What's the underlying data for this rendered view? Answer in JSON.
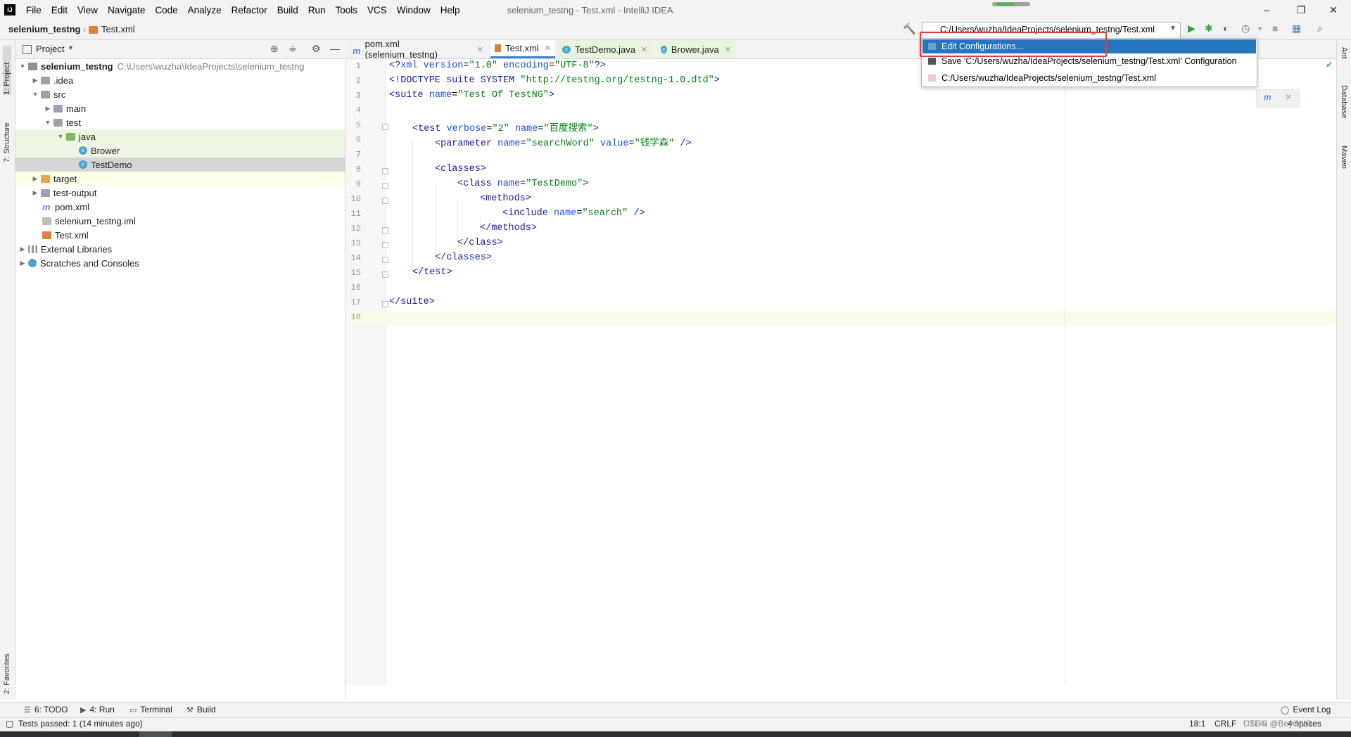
{
  "titlebar": {
    "menu": [
      "File",
      "Edit",
      "View",
      "Navigate",
      "Code",
      "Analyze",
      "Refactor",
      "Build",
      "Run",
      "Tools",
      "VCS",
      "Window",
      "Help"
    ],
    "window_title": "selenium_testng - Test.xml - IntelliJ IDEA",
    "minimize": "–",
    "restore": "❐",
    "close": "✕"
  },
  "navbar": {
    "project": "selenium_testng",
    "file": "Test.xml",
    "run_config": "C:/Users/wuzha/IdeaProjects/selenium_testng/Test.xml"
  },
  "run_dropdown": {
    "items": [
      "Edit Configurations...",
      "Save 'C:/Users/wuzha/IdeaProjects/selenium_testng/Test.xml' Configuration",
      "C:/Users/wuzha/IdeaProjects/selenium_testng/Test.xml"
    ]
  },
  "left_stripe": {
    "project": "1: Project",
    "structure": "7: Structure",
    "favorites": "2: Favorites"
  },
  "right_stripe": {
    "ant": "Ant",
    "database": "Database",
    "maven": "Maven"
  },
  "project_panel": {
    "title": "Project",
    "tree": [
      {
        "label": "selenium_testng",
        "path": "C:\\Users\\wuzha\\IdeaProjects\\selenium_testng"
      },
      {
        "label": ".idea"
      },
      {
        "label": "src"
      },
      {
        "label": "main"
      },
      {
        "label": "test"
      },
      {
        "label": "java"
      },
      {
        "label": "Brower"
      },
      {
        "label": "TestDemo"
      },
      {
        "label": "target"
      },
      {
        "label": "test-output"
      },
      {
        "label": "pom.xml"
      },
      {
        "label": "selenium_testng.iml"
      },
      {
        "label": "Test.xml"
      },
      {
        "label": "External Libraries"
      },
      {
        "label": "Scratches and Consoles"
      }
    ]
  },
  "editor_tabs": [
    "pom.xml (selenium_testng)",
    "Test.xml",
    "TestDemo.java",
    "Brower.java"
  ],
  "code": {
    "l1": {
      "a": "<?",
      "b": "xml version",
      "c": "=",
      "d": "\"1.0\"",
      "e": " encoding",
      "f": "=",
      "g": "\"UTF-8\"",
      "h": "?>"
    },
    "l2": {
      "a": "<!DOCTYPE suite SYSTEM ",
      "b": "\"http://testng.org/testng-1.0.dtd\"",
      "c": ">"
    },
    "l3": {
      "a": "<",
      "b": "suite",
      "c": " name",
      "d": "=",
      "e": "\"Test Of TestNG\"",
      "f": ">"
    },
    "l5": {
      "a": "<",
      "b": "test",
      "c": " verbose",
      "d": "=",
      "e": "\"2\"",
      "f": " name",
      "g": "=",
      "h": "\"百度搜索\"",
      "i": ">"
    },
    "l6": {
      "a": "<",
      "b": "parameter",
      "c": " name",
      "d": "=",
      "e": "\"searchWord\"",
      "f": " value",
      "g": "=",
      "h": "\"钱学森\"",
      "i": " />"
    },
    "l8": {
      "a": "<",
      "b": "classes",
      "c": ">"
    },
    "l9": {
      "a": "<",
      "b": "class",
      "c": " name",
      "d": "=",
      "e": "\"TestDemo\"",
      "f": ">"
    },
    "l10": {
      "a": "<",
      "b": "methods",
      "c": ">"
    },
    "l11": {
      "a": "<",
      "b": "include",
      "c": " name",
      "d": "=",
      "e": "\"search\"",
      "f": " />"
    },
    "l12": {
      "a": "</",
      "b": "methods",
      "c": ">"
    },
    "l13": {
      "a": "</",
      "b": "class",
      "c": ">"
    },
    "l14": {
      "a": "</",
      "b": "classes",
      "c": ">"
    },
    "l15": {
      "a": "</",
      "b": "test",
      "c": ">"
    },
    "l17": {
      "a": "</",
      "b": "suite",
      "c": ">"
    }
  },
  "line_numbers": [
    "1",
    "2",
    "3",
    "4",
    "5",
    "6",
    "7",
    "8",
    "9",
    "10",
    "11",
    "12",
    "13",
    "14",
    "15",
    "16",
    "17",
    "18"
  ],
  "bottom_tools": {
    "todo": "6: TODO",
    "run": "4: Run",
    "terminal": "Terminal",
    "build": "Build",
    "event_log": "Event Log"
  },
  "status": {
    "message": "Tests passed: 1 (14 minutes ago)",
    "position": "18:1",
    "line_sep": "CRLF",
    "encoding": "UTF-8",
    "indent": "4 spaces",
    "watermark": "CSDN @BeyONG"
  },
  "colors": {
    "accent": "#2675bf",
    "highlight_box": "#e53b3b",
    "run_green": "#3c9d3c"
  }
}
